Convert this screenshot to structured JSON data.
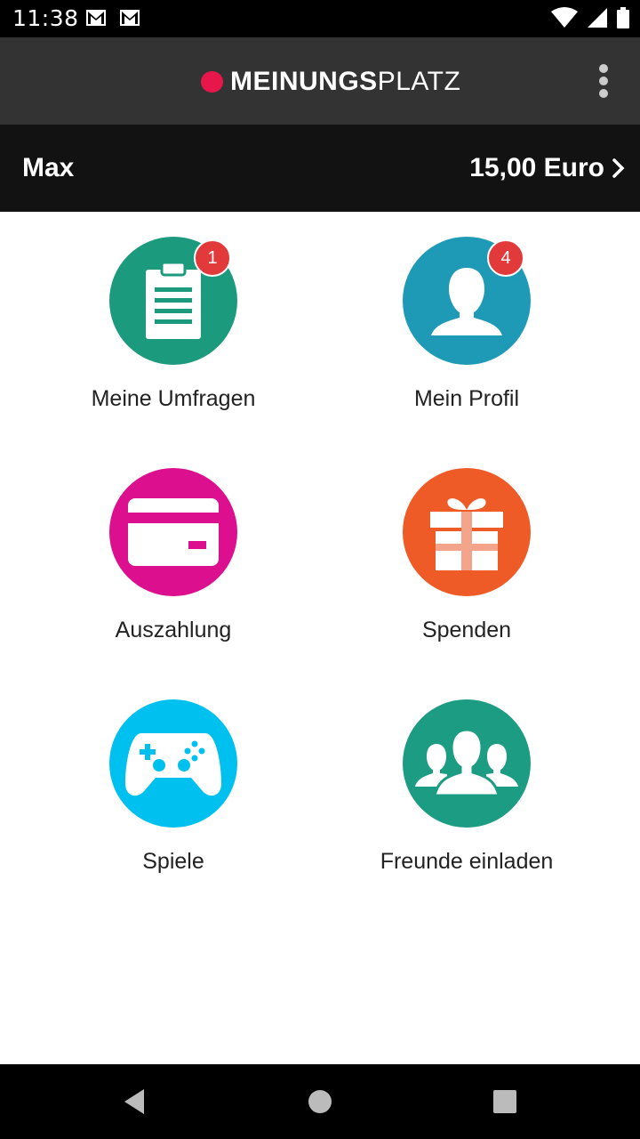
{
  "status": {
    "time": "11:38"
  },
  "app": {
    "brand_bold": "MEINUNGS",
    "brand_light": "PLATZ",
    "brand_color": "#e8174b"
  },
  "user": {
    "name": "Max",
    "balance": "15,00 Euro"
  },
  "tiles": [
    {
      "label": "Meine Umfragen",
      "color": "#1b9a7d",
      "icon": "clipboard-icon",
      "badge": "1"
    },
    {
      "label": "Mein Profil",
      "color": "#1e9ab7",
      "icon": "person-icon",
      "badge": "4"
    },
    {
      "label": "Auszahlung",
      "color": "#dc0f8e",
      "icon": "credit-card-icon"
    },
    {
      "label": "Spenden",
      "color": "#ef5b27",
      "icon": "gift-icon"
    },
    {
      "label": "Spiele",
      "color": "#00c0f0",
      "icon": "gamepad-icon"
    },
    {
      "label": "Freunde einladen",
      "color": "#1c9c82",
      "icon": "group-icon"
    }
  ]
}
